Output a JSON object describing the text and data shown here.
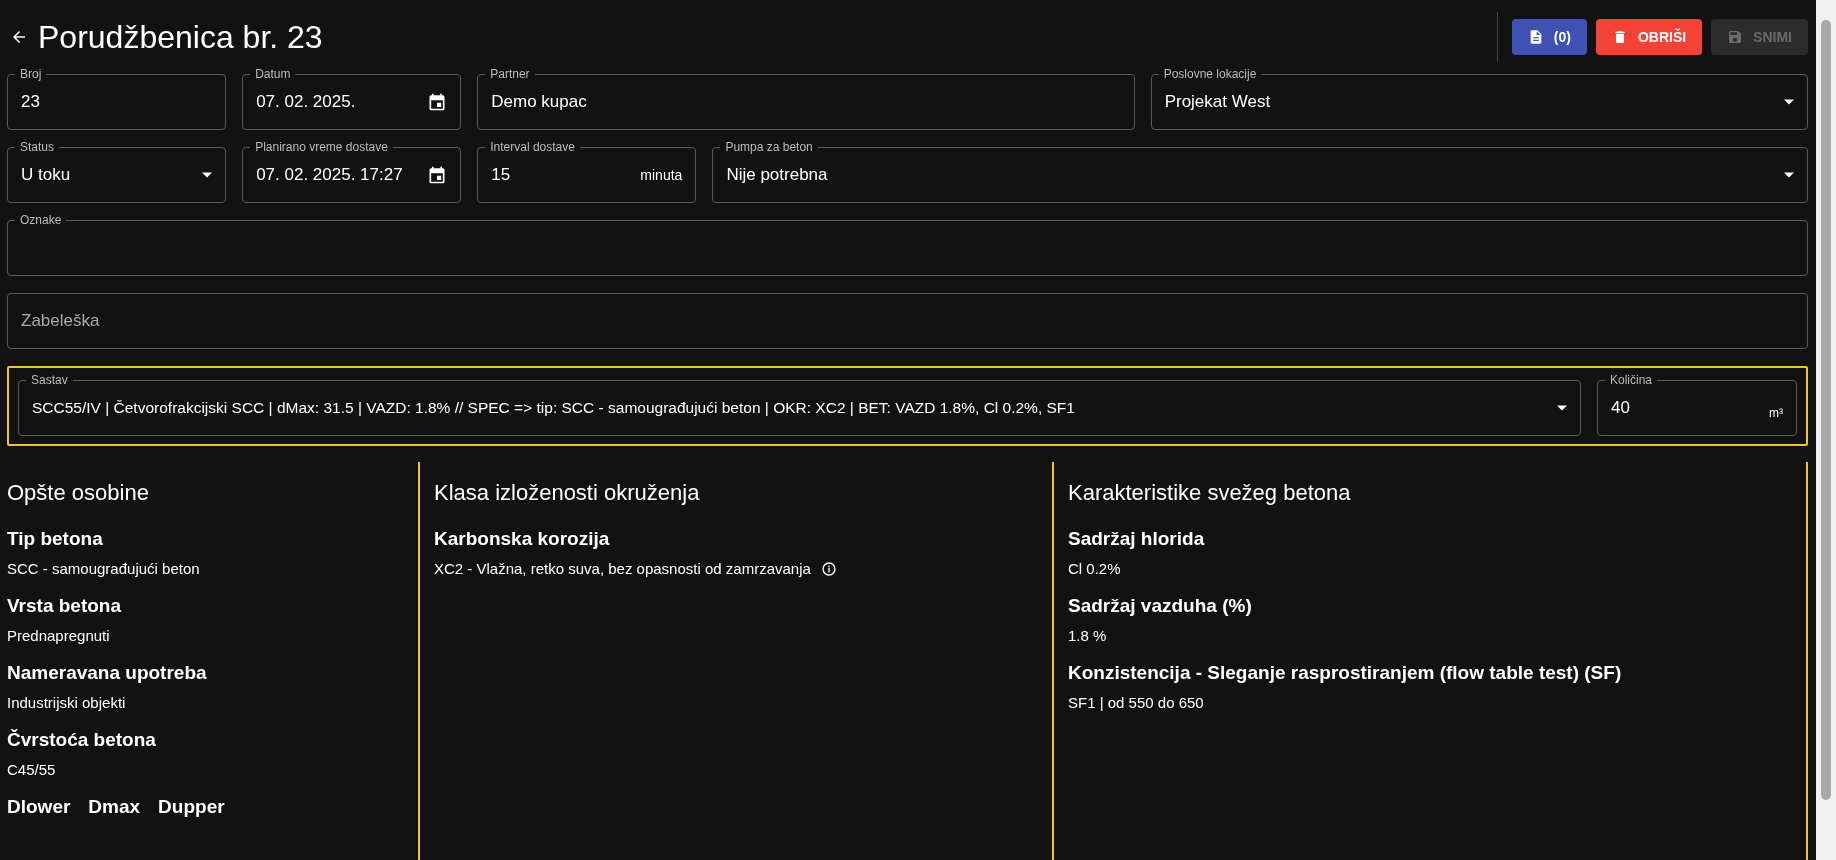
{
  "header": {
    "title": "Porudžbenica br. 23",
    "buttons": [
      {
        "kind": "documents",
        "label": "(0)",
        "disabled": false
      },
      {
        "kind": "delete",
        "label": "OBRIŠI",
        "disabled": false
      },
      {
        "kind": "save",
        "label": "SNIMI",
        "disabled": true
      }
    ]
  },
  "form_rows": [
    [
      {
        "kind": "text",
        "label": "Broj",
        "value": "23"
      },
      {
        "kind": "date",
        "label": "Datum",
        "value": "07. 02. 2025."
      },
      {
        "kind": "text",
        "label": "Partner",
        "value": "Demo kupac"
      },
      {
        "kind": "select",
        "label": "Poslovne lokacije",
        "value": "Projekat West"
      }
    ],
    [
      {
        "kind": "select",
        "label": "Status",
        "value": "U toku"
      },
      {
        "kind": "date",
        "label": "Planirano vreme dostave",
        "value": "07. 02. 2025. 17:27"
      },
      {
        "kind": "unit",
        "label": "Interval dostave",
        "value": "15",
        "unit": "minuta"
      },
      {
        "kind": "select",
        "label": "Pumpa za beton",
        "value": "Nije potrebna"
      }
    ],
    [
      {
        "kind": "text",
        "label": "Oznake"
      }
    ],
    [
      {
        "kind": "text",
        "placeholder": "Zabeleška"
      }
    ]
  ],
  "composition": {
    "mix": {
      "label": "Sastav",
      "value": "SCC55/IV | Četvorofrakcijski SCC | dMax: 31.5 | VAZD: 1.8%  //   SPEC => tip: SCC - samougrađujući beton | OKR: XC2 | BET: VAZD 1.8%, Cl 0.2%, SF1"
    },
    "quantity": {
      "label": "Količina",
      "value": "40",
      "unit": "m³"
    }
  },
  "sections": [
    {
      "title": "Opšte osobine",
      "items": [
        {
          "kind": "property",
          "label": "Tip betona",
          "value": "SCC - samougrađujući beton"
        },
        {
          "kind": "property",
          "label": "Vrsta betona",
          "value": "Prednapregnuti"
        },
        {
          "kind": "property",
          "label": "Nameravana upotreba",
          "value": "Industrijski objekti"
        },
        {
          "kind": "property",
          "label": "Čvrstoća betona",
          "value": "C45/55"
        },
        {
          "kind": "headings",
          "labels": [
            "Dlower",
            "Dmax",
            "Dupper"
          ]
        }
      ]
    },
    {
      "title": "Klasa izloženosti okruženja",
      "items": [
        {
          "kind": "property",
          "label": "Karbonska korozija",
          "value": "XC2 - Vlažna, retko suva, bez opasnosti od zamrzavanja",
          "info": true
        }
      ]
    },
    {
      "title": "Karakteristike svežeg betona",
      "items": [
        {
          "kind": "property",
          "label": "Sadržaj hlorida",
          "value": "Cl 0.2%"
        },
        {
          "kind": "property",
          "label": "Sadržaj vazduha (%)",
          "value": "1.8 %"
        },
        {
          "kind": "property",
          "label": "Konzistencija - Sleganje rasprostiranjem (flow table test) (SF)",
          "value": "SF1 | od 550 do 650"
        }
      ]
    }
  ]
}
